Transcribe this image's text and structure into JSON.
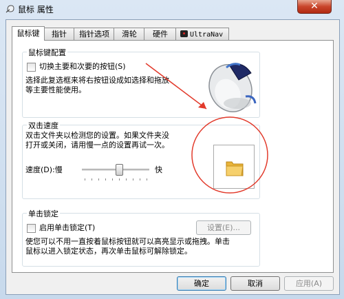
{
  "window": {
    "title": "鼠标 属性",
    "close_symbol": "✕"
  },
  "tabs": [
    {
      "label": "鼠标键",
      "active": true
    },
    {
      "label": "指针"
    },
    {
      "label": "指针选项"
    },
    {
      "label": "滑轮"
    },
    {
      "label": "硬件"
    },
    {
      "label": "UltraNav",
      "icon": "thinkpad-icon"
    }
  ],
  "button_config": {
    "title": "鼠标键配置",
    "checkbox_label": "切换主要和次要的按钮(S)",
    "checked": false,
    "description_line1": "选择此复选框来将右按钮设成如选择和拖放",
    "description_line2": "等主要性能使用。"
  },
  "double_click": {
    "title": "双击速度",
    "description_line1": "双击文件夹以检测您的设置。如果文件夹没",
    "description_line2": "打开或关闭，请用慢一点的设置再试一次。",
    "speed_label": "速度(D):慢",
    "fast_label": "快",
    "speed_level": 0.55
  },
  "click_lock": {
    "title": "单击锁定",
    "checkbox_label": "启用单击锁定(T)",
    "checked": false,
    "settings_button": "设置(E)...",
    "description_line1": "使您可以不用一直按着鼠标按钮就可以高亮显示或拖拽。单击",
    "description_line2": "鼠标以进入锁定状态，再次单击鼠标可解除锁定。"
  },
  "footer": {
    "ok": "确定",
    "cancel": "取消",
    "apply": "应用(A)"
  },
  "colors": {
    "annotation_red": "#e23a2b",
    "folder": "#e9b43a"
  }
}
